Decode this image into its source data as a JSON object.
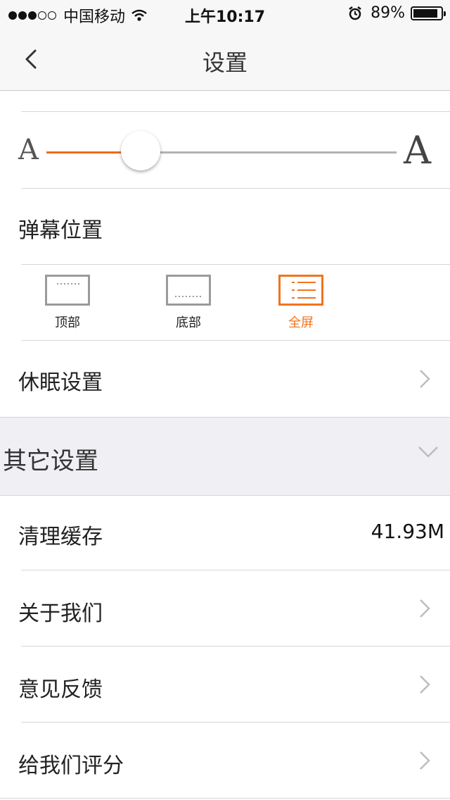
{
  "status_bar": {
    "signal_filled": 3,
    "signal_total": 5,
    "carrier": "中国移动",
    "time": "上午10:17",
    "battery": "89%",
    "battery_level": 0.89
  },
  "nav": {
    "title": "设置",
    "back_icon": "chevron-left-icon"
  },
  "font_size": {
    "small_label": "A",
    "large_label": "A",
    "level": 0.27,
    "accent_color": "#ee6c1d"
  },
  "danmaku": {
    "label": "弹幕位置",
    "options": [
      {
        "label": "顶部",
        "active": false
      },
      {
        "label": "底部",
        "active": false
      },
      {
        "label": "全屏",
        "active": true
      }
    ]
  },
  "sleep": {
    "label": "休眠设置"
  },
  "other_section": {
    "title": "其它设置",
    "icon": "chevron-down-icon"
  },
  "items": {
    "clear_cache": {
      "label": "清理缓存",
      "value": "41.93M"
    },
    "about": {
      "label": "关于我们"
    },
    "feedback": {
      "label": "意见反馈"
    },
    "rate": {
      "label": "给我们评分"
    }
  }
}
